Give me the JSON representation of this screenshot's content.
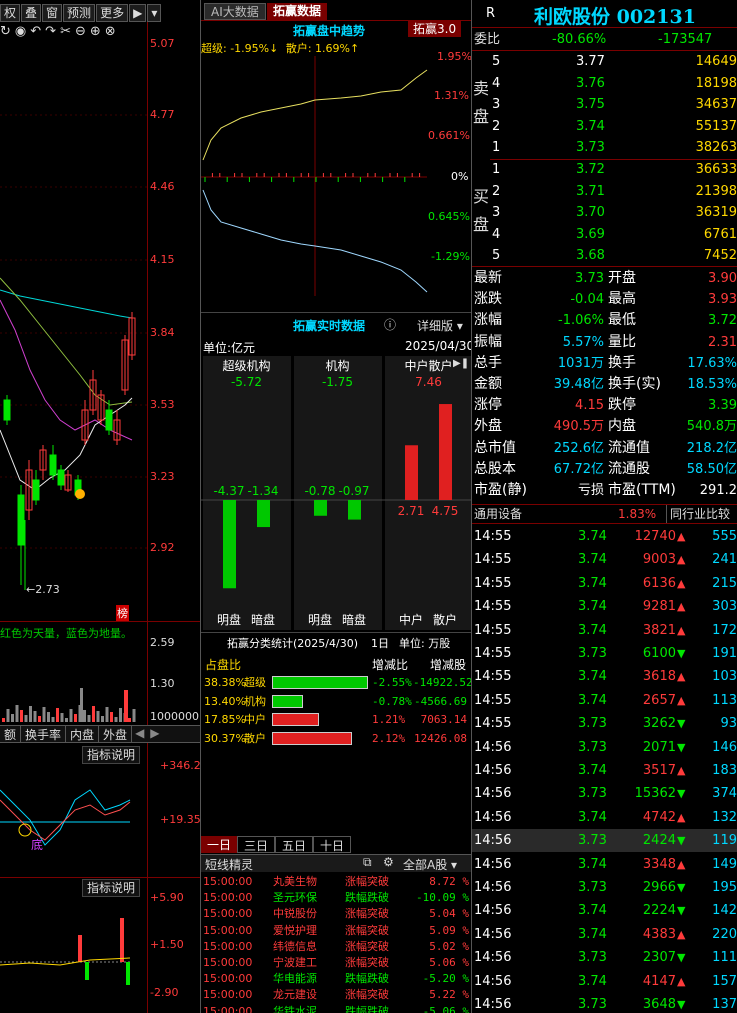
{
  "left": {
    "toolbar": [
      "权",
      "叠",
      "窗",
      "预测",
      "更多",
      "▶"
    ],
    "price_axis": [
      "5.07",
      "4.77",
      "4.46",
      "4.15",
      "3.84",
      "3.53",
      "3.23",
      "2.92"
    ],
    "low_label": "2.73",
    "rank_badge": "榜",
    "volume_note": "红色为天量，蓝色为地量。",
    "volume_axis": [
      "2.59",
      "1.30",
      "1000000"
    ],
    "tabs": [
      "额",
      "换手率",
      "内盘",
      "外盘"
    ],
    "ind1_title": "指标说明",
    "ind1_axis": [
      "+346.2",
      "+19.35"
    ],
    "ind1_marker": "底",
    "ind2_title": "指标说明",
    "ind2_axis": [
      "+5.90",
      "+1.50",
      "-2.90"
    ]
  },
  "mid": {
    "tab_ai": "AI大数据",
    "tab_tz": "拓赢数据",
    "trend_title": "拓赢盘中趋势",
    "trend_badge": "拓赢3.0",
    "trend_legend_super": "超级: -1.95%↓",
    "trend_legend_retail": "散户: 1.69%↑",
    "trend_axis": [
      "1.95%",
      "1.31%",
      "0.661%",
      "0%",
      "0.645%",
      "-1.29%"
    ],
    "rt_title": "拓赢实时数据",
    "rt_detail": "详细版",
    "unit": "单位:亿元",
    "date": "2025/04/30",
    "cols": [
      {
        "name": "超级机构",
        "total": "-5.72",
        "a": "-4.37",
        "b": "-1.34",
        "la": "明盘",
        "lb": "暗盘"
      },
      {
        "name": "机构",
        "total": "-1.75",
        "a": "-0.78",
        "b": "-0.97",
        "la": "明盘",
        "lb": "暗盘"
      },
      {
        "name": "中户散户",
        "total": "7.46",
        "a": "2.71",
        "b": "4.75",
        "la": "中户",
        "lb": "散户"
      }
    ],
    "stats_title": "拓赢分类统计(2025/4/30)",
    "stats_day": "1日",
    "stats_unit": "单位: 万股",
    "stats_hdr": [
      "占盘比",
      "增减比",
      "增减股"
    ],
    "stats": [
      {
        "pct": "38.38%",
        "name": "超级",
        "ratio": "-2.55%",
        "shares": "-14922.52",
        "frac": 1.0,
        "color": "#00c800"
      },
      {
        "pct": "13.40%",
        "name": "机构",
        "ratio": "-0.78%",
        "shares": "-4566.69",
        "frac": 0.32,
        "color": "#00c800"
      },
      {
        "pct": "17.85%",
        "name": "中户",
        "ratio": "1.21%",
        "shares": "7063.14",
        "frac": 0.49,
        "color": "#e02020"
      },
      {
        "pct": "30.37%",
        "name": "散户",
        "ratio": "2.12%",
        "shares": "12426.08",
        "frac": 0.83,
        "color": "#e02020"
      }
    ],
    "day_tabs": [
      "一日",
      "三日",
      "五日",
      "十日"
    ],
    "short_title": "短线精灵",
    "short_filter": "全部A股",
    "short_rows": [
      {
        "t": "15:00:00",
        "name": "丸美生物",
        "ev": "涨幅突破",
        "v": "8.72 %",
        "up": true
      },
      {
        "t": "15:00:00",
        "name": "圣元环保",
        "ev": "跌幅跌破",
        "v": "-10.09 %",
        "up": false
      },
      {
        "t": "15:00:00",
        "name": "中锐股份",
        "ev": "涨幅突破",
        "v": "5.04 %",
        "up": true
      },
      {
        "t": "15:00:00",
        "name": "爱悦护理",
        "ev": "涨幅突破",
        "v": "5.09 %",
        "up": true
      },
      {
        "t": "15:00:00",
        "name": "纬德信息",
        "ev": "涨幅突破",
        "v": "5.02 %",
        "up": true
      },
      {
        "t": "15:00:00",
        "name": "宁波建工",
        "ev": "涨幅突破",
        "v": "5.06 %",
        "up": true
      },
      {
        "t": "15:00:00",
        "name": "华电能源",
        "ev": "跌幅跌破",
        "v": "-5.20 %",
        "up": false
      },
      {
        "t": "15:00:00",
        "name": "龙元建设",
        "ev": "涨幅突破",
        "v": "5.22 %",
        "up": true
      },
      {
        "t": "15:00:00",
        "name": "华铁水泥",
        "ev": "跌幅跌破",
        "v": "-5.06 %",
        "up": false
      }
    ]
  },
  "right": {
    "r_badge": "R",
    "stock": "利欧股份 002131",
    "weibi_label": "委比",
    "weibi_pct": "-80.66%",
    "weibi_val": "-173547",
    "sell_label": [
      "卖",
      "盘"
    ],
    "buy_label": [
      "买",
      "盘"
    ],
    "sells": [
      {
        "lvl": "5",
        "p": "3.77",
        "v": "14649"
      },
      {
        "lvl": "4",
        "p": "3.76",
        "v": "18198"
      },
      {
        "lvl": "3",
        "p": "3.75",
        "v": "34637"
      },
      {
        "lvl": "2",
        "p": "3.74",
        "v": "55137"
      },
      {
        "lvl": "1",
        "p": "3.73",
        "v": "38263"
      }
    ],
    "buys": [
      {
        "lvl": "1",
        "p": "3.72",
        "v": "36633"
      },
      {
        "lvl": "2",
        "p": "3.71",
        "v": "21398"
      },
      {
        "lvl": "3",
        "p": "3.70",
        "v": "36319"
      },
      {
        "lvl": "4",
        "p": "3.69",
        "v": "6761"
      },
      {
        "lvl": "5",
        "p": "3.68",
        "v": "7452"
      }
    ],
    "quotes": [
      {
        "l1": "最新",
        "v1": "3.73",
        "c1": "grn",
        "l2": "开盘",
        "v2": "3.90",
        "c2": "red"
      },
      {
        "l1": "涨跌",
        "v1": "-0.04",
        "c1": "grn",
        "l2": "最高",
        "v2": "3.93",
        "c2": "red"
      },
      {
        "l1": "涨幅",
        "v1": "-1.06%",
        "c1": "grn",
        "l2": "最低",
        "v2": "3.72",
        "c2": "grn"
      },
      {
        "l1": "振幅",
        "v1": "5.57%",
        "c1": "cyan",
        "l2": "量比",
        "v2": "2.31",
        "c2": "red"
      },
      {
        "l1": "总手",
        "v1": "1031万",
        "c1": "cyan",
        "l2": "换手",
        "v2": "17.63%",
        "c2": "cyan"
      },
      {
        "l1": "金额",
        "v1": "39.48亿",
        "c1": "cyan",
        "l2": "换手(实)",
        "v2": "18.53%",
        "c2": "cyan"
      },
      {
        "l1": "涨停",
        "v1": "4.15",
        "c1": "red",
        "l2": "跌停",
        "v2": "3.39",
        "c2": "grn"
      },
      {
        "l1": "外盘",
        "v1": "490.5万",
        "c1": "red",
        "l2": "内盘",
        "v2": "540.8万",
        "c2": "grn"
      },
      {
        "l1": "总市值",
        "v1": "252.6亿",
        "c1": "cyan",
        "l2": "流通值",
        "v2": "218.2亿",
        "c2": "cyan"
      },
      {
        "l1": "总股本",
        "v1": "67.72亿",
        "c1": "cyan",
        "l2": "流通股",
        "v2": "58.50亿",
        "c2": "cyan"
      },
      {
        "l1": "市盈(静)",
        "v1": "亏损",
        "c1": "wht",
        "l2": "市盈(TTM)",
        "v2": "291.2",
        "c2": "wht"
      }
    ],
    "industry_label": "通用设备",
    "industry_pct": "1.83%",
    "industry_btn": "同行业比较",
    "ticks": [
      {
        "t": "14:55",
        "p": "3.74",
        "v": "12740",
        "up": true,
        "n": "555"
      },
      {
        "t": "14:55",
        "p": "3.74",
        "v": "9003",
        "up": true,
        "n": "241"
      },
      {
        "t": "14:55",
        "p": "3.74",
        "v": "6136",
        "up": true,
        "n": "215"
      },
      {
        "t": "14:55",
        "p": "3.74",
        "v": "9281",
        "up": true,
        "n": "303"
      },
      {
        "t": "14:55",
        "p": "3.74",
        "v": "3821",
        "up": true,
        "n": "172"
      },
      {
        "t": "14:55",
        "p": "3.73",
        "v": "6100",
        "up": false,
        "n": "191"
      },
      {
        "t": "14:55",
        "p": "3.74",
        "v": "3618",
        "up": true,
        "n": "103"
      },
      {
        "t": "14:55",
        "p": "3.74",
        "v": "2657",
        "up": true,
        "n": "113"
      },
      {
        "t": "14:55",
        "p": "3.73",
        "v": "3262",
        "up": false,
        "n": "93"
      },
      {
        "t": "14:56",
        "p": "3.73",
        "v": "2071",
        "up": false,
        "n": "146"
      },
      {
        "t": "14:56",
        "p": "3.74",
        "v": "3517",
        "up": true,
        "n": "183"
      },
      {
        "t": "14:56",
        "p": "3.73",
        "v": "15362",
        "up": false,
        "n": "374"
      },
      {
        "t": "14:56",
        "p": "3.74",
        "v": "4742",
        "up": true,
        "n": "132"
      },
      {
        "t": "14:56",
        "p": "3.73",
        "v": "2424",
        "up": false,
        "n": "119",
        "sel": true
      },
      {
        "t": "14:56",
        "p": "3.74",
        "v": "3348",
        "up": true,
        "n": "149"
      },
      {
        "t": "14:56",
        "p": "3.73",
        "v": "2966",
        "up": false,
        "n": "195"
      },
      {
        "t": "14:56",
        "p": "3.74",
        "v": "2224",
        "up": false,
        "n": "142"
      },
      {
        "t": "14:56",
        "p": "3.74",
        "v": "4383",
        "up": true,
        "n": "220"
      },
      {
        "t": "14:56",
        "p": "3.73",
        "v": "2307",
        "up": false,
        "n": "111"
      },
      {
        "t": "14:56",
        "p": "3.74",
        "v": "4147",
        "up": true,
        "n": "157"
      },
      {
        "t": "14:56",
        "p": "3.73",
        "v": "3648",
        "up": false,
        "n": "137"
      }
    ]
  },
  "colors": {
    "up": "#ff3b3b",
    "down": "#00e600",
    "accent": "#00d8ff",
    "grid": "#7a0000"
  }
}
